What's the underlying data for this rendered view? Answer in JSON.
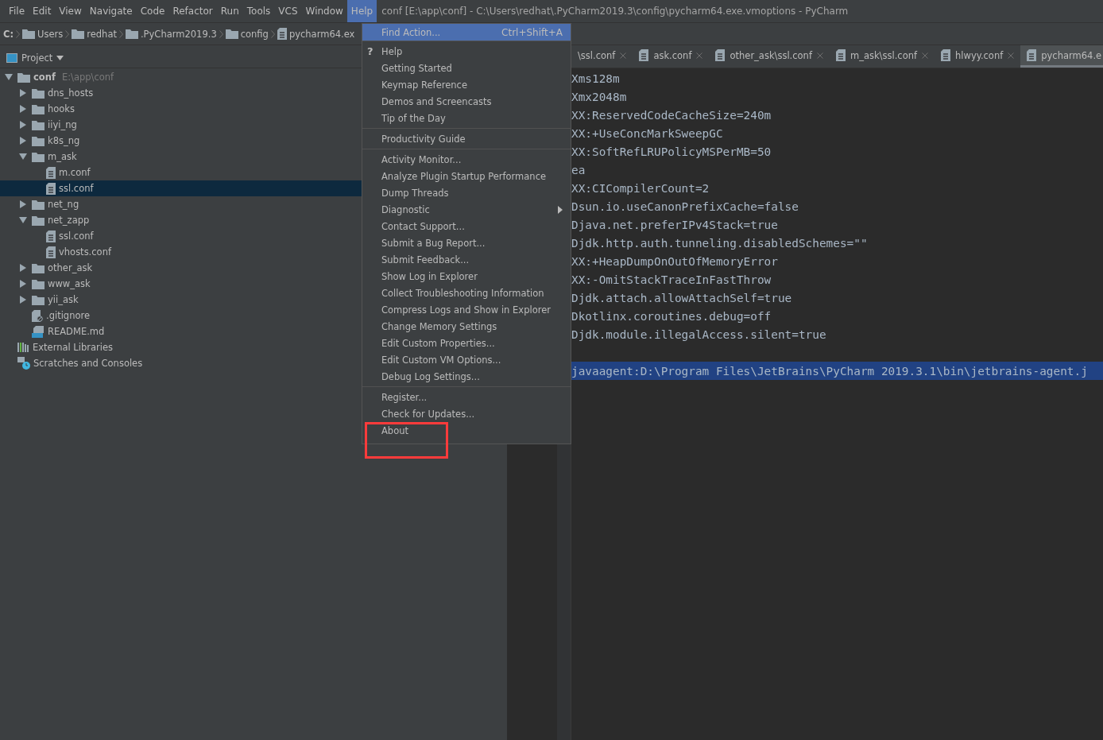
{
  "menu_bar": [
    {
      "label": "File",
      "selected": false
    },
    {
      "label": "Edit",
      "selected": false
    },
    {
      "label": "View",
      "selected": false
    },
    {
      "label": "Navigate",
      "selected": false
    },
    {
      "label": "Code",
      "selected": false
    },
    {
      "label": "Refactor",
      "selected": false
    },
    {
      "label": "Run",
      "selected": false
    },
    {
      "label": "Tools",
      "selected": false
    },
    {
      "label": "VCS",
      "selected": false
    },
    {
      "label": "Window",
      "selected": false
    },
    {
      "label": "Help",
      "selected": true
    }
  ],
  "window": {
    "title": "conf [E:\\app\\conf] - C:\\Users\\redhat\\.PyCharm2019.3\\config\\pycharm64.exe.vmoptions - PyCharm"
  },
  "breadcrumbs": [
    {
      "label": "C:",
      "kind": "drive"
    },
    {
      "label": "Users",
      "kind": "folder"
    },
    {
      "label": "redhat",
      "kind": "folder"
    },
    {
      "label": ".PyCharm2019.3",
      "kind": "folder"
    },
    {
      "label": "config",
      "kind": "folder"
    },
    {
      "label": "pycharm64.ex",
      "kind": "file"
    }
  ],
  "project_panel": {
    "title": "Project",
    "tree": [
      {
        "label": "conf",
        "hint": "E:\\app\\conf",
        "kind": "folder",
        "expanded": true,
        "selected": false,
        "children": [
          {
            "label": "dns_hosts",
            "kind": "folder",
            "expanded": false,
            "selected": false
          },
          {
            "label": "hooks",
            "kind": "folder",
            "expanded": false,
            "selected": false
          },
          {
            "label": "iiyi_ng",
            "kind": "folder",
            "expanded": false,
            "selected": false
          },
          {
            "label": "k8s_ng",
            "kind": "folder",
            "expanded": false,
            "selected": false
          },
          {
            "label": "m_ask",
            "kind": "folder",
            "expanded": true,
            "selected": false,
            "children": [
              {
                "label": "m.conf",
                "kind": "file",
                "selected": false
              },
              {
                "label": "ssl.conf",
                "kind": "file",
                "selected": true
              }
            ]
          },
          {
            "label": "net_ng",
            "kind": "folder",
            "expanded": false,
            "selected": false
          },
          {
            "label": "net_zapp",
            "kind": "folder",
            "expanded": true,
            "selected": false,
            "children": [
              {
                "label": "ssl.conf",
                "kind": "file",
                "selected": false
              },
              {
                "label": "vhosts.conf",
                "kind": "file",
                "selected": false
              }
            ]
          },
          {
            "label": "other_ask",
            "kind": "folder",
            "expanded": false,
            "selected": false
          },
          {
            "label": "www_ask",
            "kind": "folder",
            "expanded": false,
            "selected": false
          },
          {
            "label": "yii_ask",
            "kind": "folder",
            "expanded": false,
            "selected": false
          },
          {
            "label": ".gitignore",
            "kind": "ignore",
            "selected": false
          },
          {
            "label": "README.md",
            "kind": "markdown",
            "selected": false
          }
        ]
      },
      {
        "label": "External Libraries",
        "kind": "libraries",
        "selected": false
      },
      {
        "label": "Scratches and Consoles",
        "kind": "scratches",
        "selected": false
      }
    ]
  },
  "editor": {
    "tabs": [
      {
        "label": "\\ssl.conf",
        "selected": false
      },
      {
        "label": "ask.conf",
        "selected": false
      },
      {
        "label": "other_ask\\ssl.conf",
        "selected": false
      },
      {
        "label": "m_ask\\ssl.conf",
        "selected": false
      },
      {
        "label": "hlwyy.conf",
        "selected": false
      },
      {
        "label": "pycharm64.e",
        "selected": true
      }
    ],
    "lines": [
      {
        "text": "Xms128m",
        "selected": false
      },
      {
        "text": "Xmx2048m",
        "selected": false
      },
      {
        "text": "XX:ReservedCodeCacheSize=240m",
        "selected": false
      },
      {
        "text": "XX:+UseConcMarkSweepGC",
        "selected": false
      },
      {
        "text": "XX:SoftRefLRUPolicyMSPerMB=50",
        "selected": false
      },
      {
        "text": "ea",
        "selected": false
      },
      {
        "text": "XX:CICompilerCount=2",
        "selected": false
      },
      {
        "text": "Dsun.io.useCanonPrefixCache=false",
        "selected": false
      },
      {
        "text": "Djava.net.preferIPv4Stack=true",
        "selected": false
      },
      {
        "text": "Djdk.http.auth.tunneling.disabledSchemes=\"\"",
        "selected": false
      },
      {
        "text": "XX:+HeapDumpOnOutOfMemoryError",
        "selected": false
      },
      {
        "text": "XX:-OmitStackTraceInFastThrow",
        "selected": false
      },
      {
        "text": "Djdk.attach.allowAttachSelf=true",
        "selected": false
      },
      {
        "text": "Dkotlinx.coroutines.debug=off",
        "selected": false
      },
      {
        "text": "Djdk.module.illegalAccess.silent=true",
        "selected": false
      },
      {
        "selected": false
      },
      {
        "text": "javaagent:D:\\Program Files\\JetBrains\\PyCharm 2019.3.1\\bin\\jetbrains-agent.j",
        "selected": true
      }
    ]
  },
  "help_menu": {
    "groups": [
      [
        {
          "label": "Find Action...",
          "shortcut": "Ctrl+Shift+A",
          "selected": true
        }
      ],
      [
        {
          "label": "Help",
          "icon": "?",
          "selected": false
        },
        {
          "label": "Getting Started",
          "selected": false
        },
        {
          "label": "Keymap Reference",
          "selected": false
        },
        {
          "label": "Demos and Screencasts",
          "selected": false
        },
        {
          "label": "Tip of the Day",
          "selected": false
        }
      ],
      [
        {
          "label": "Productivity Guide",
          "selected": false
        }
      ],
      [
        {
          "label": "Activity Monitor...",
          "selected": false
        },
        {
          "label": "Analyze Plugin Startup Performance",
          "selected": false
        },
        {
          "label": "Dump Threads",
          "selected": false
        },
        {
          "label": "Diagnostic",
          "kind": "submenu",
          "selected": false
        },
        {
          "label": "Contact Support...",
          "selected": false
        },
        {
          "label": "Submit a Bug Report...",
          "selected": false
        },
        {
          "label": "Submit Feedback...",
          "selected": false
        },
        {
          "label": "Show Log in Explorer",
          "selected": false
        },
        {
          "label": "Collect Troubleshooting Information",
          "selected": false
        },
        {
          "label": "Compress Logs and Show in Explorer",
          "selected": false
        },
        {
          "label": "Change Memory Settings",
          "selected": false
        },
        {
          "label": "Edit Custom Properties...",
          "selected": false
        },
        {
          "label": "Edit Custom VM Options...",
          "selected": false
        },
        {
          "label": "Debug Log Settings...",
          "selected": false
        }
      ],
      [
        {
          "label": "Register...",
          "selected": false
        },
        {
          "label": "Check for Updates...",
          "selected": false
        },
        {
          "label": "About",
          "selected": false
        }
      ]
    ],
    "annotation_visible": true
  }
}
